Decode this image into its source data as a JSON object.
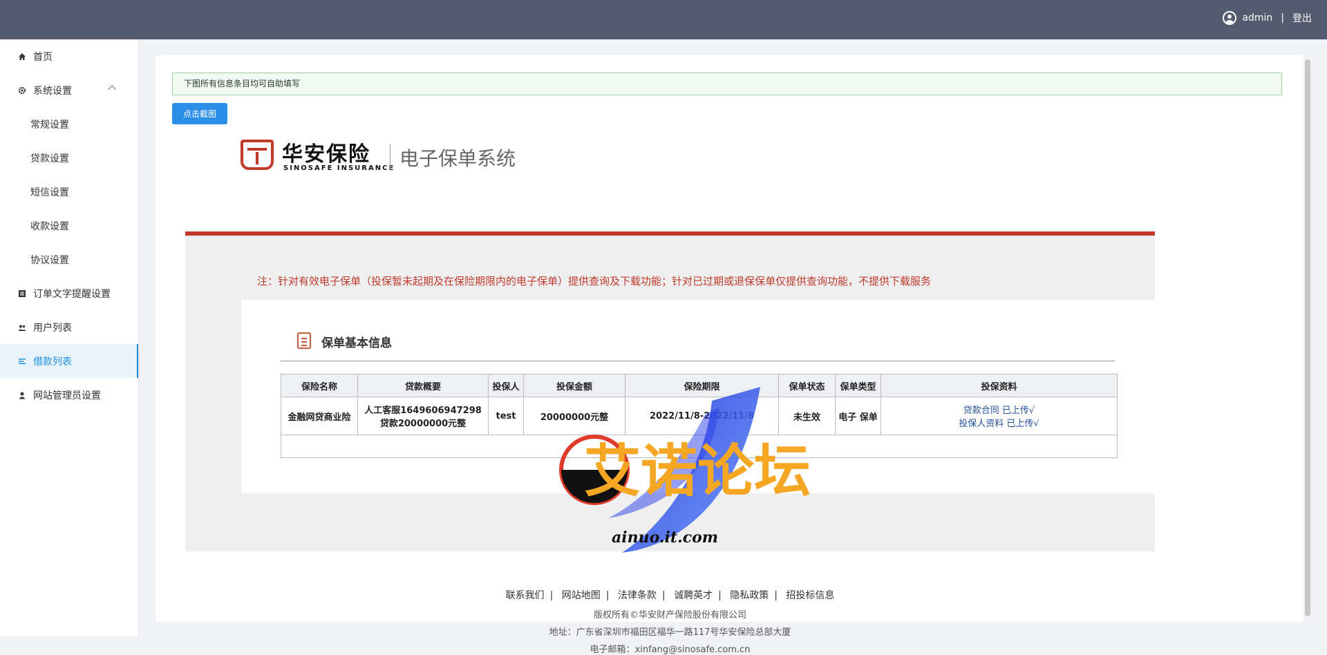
{
  "header": {
    "username": "admin",
    "separator": "|",
    "logout_label": "登出"
  },
  "sidebar": {
    "items": [
      {
        "label": "首页",
        "icon": "home-icon"
      },
      {
        "label": "系统设置",
        "icon": "gear-icon"
      },
      {
        "label": "常规设置"
      },
      {
        "label": "贷款设置"
      },
      {
        "label": "短信设置"
      },
      {
        "label": "收款设置"
      },
      {
        "label": "协议设置"
      },
      {
        "label": "订单文字提醒设置",
        "icon": "list-icon"
      },
      {
        "label": "用户列表",
        "icon": "users-icon"
      },
      {
        "label": "借款列表",
        "icon": "menu-icon",
        "active": true
      },
      {
        "label": "网站管理员设置",
        "icon": "user-icon"
      }
    ]
  },
  "main": {
    "notice": "下图所有信息条目均可自助填写",
    "capture_button": "点击截图"
  },
  "document": {
    "logo_cn": "华安保险",
    "logo_en": "SINOSAFE INSURANCE",
    "system_name": "电子保单系统",
    "red_note": "注：针对有效电子保单（投保暂未起期及在保险期限内的电子保单）提供查询及下载功能；针对已过期或退保保单仅提供查询功能，不提供下载服务",
    "section_title": "保单基本信息",
    "table": {
      "headers": [
        "保险名称",
        "贷款概要",
        "投保人",
        "投保金额",
        "保险期限",
        "保单状态",
        "保单类型",
        "投保资料"
      ],
      "row": {
        "name": "金融网贷商业险",
        "summary_line1": "人工客服1649606947298",
        "summary_line2": "贷款20000000元整",
        "insured": "test",
        "amount": "20000000元整",
        "period": "2022/11/8-2022/11/8",
        "status": "未生效",
        "type": "电子 保单",
        "material_line1": "贷款合同 已上传√",
        "material_line2": "投保人资料 已上传√"
      }
    },
    "footer_links": [
      "联系我们",
      "网站地图",
      "法律条款",
      "诚聘英才",
      "隐私政策",
      "招投标信息"
    ],
    "footer_copyright": "版权所有©华安财产保险股份有限公司",
    "footer_address": "地址：广东省深圳市福田区福华一路117号华安保险总部大厦",
    "footer_email": "电子邮箱：xinfang@sinosafe.com.cn"
  },
  "watermark": {
    "text": "艾诺论坛",
    "url": "ainuo.it.com"
  },
  "colors": {
    "topbar": "#545b6f",
    "accent": "#1d8ce0",
    "brand_red": "#c0392b",
    "button_blue": "#2b8ee8"
  }
}
